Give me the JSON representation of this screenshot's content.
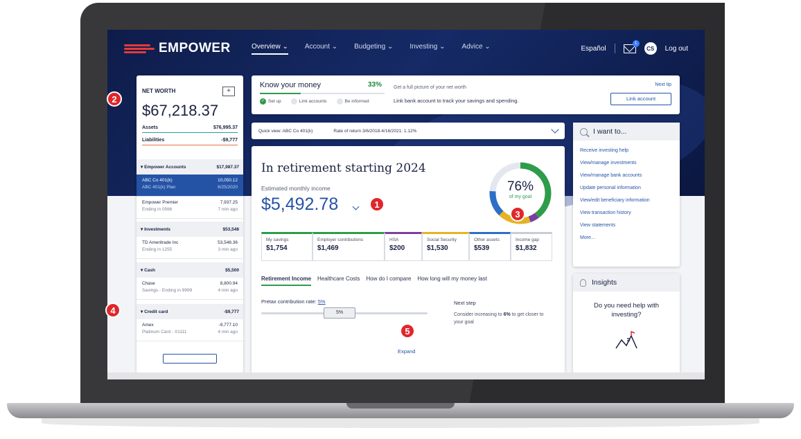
{
  "header": {
    "brand": "EMPOWER",
    "nav": [
      {
        "label": "Overview ⌄"
      },
      {
        "label": "Account ⌄"
      },
      {
        "label": "Budgeting ⌄"
      },
      {
        "label": "Investing ⌄"
      },
      {
        "label": "Advice ⌄"
      }
    ],
    "language": "Español",
    "mail_badge": "1",
    "avatar_initials": "CS",
    "logout": "Log out"
  },
  "net_worth": {
    "title": "NET WORTH",
    "add_label": "+",
    "value": "$67,218.37",
    "assets_label": "Assets",
    "assets_value": "$76,995.37",
    "liabilities_label": "Liabilities",
    "liabilities_value": "-$9,777",
    "sections": [
      {
        "label": "▾ Empower Accounts",
        "value": "$17,987.37"
      },
      {
        "label": "▾ Investments",
        "value": "$53,548"
      },
      {
        "label": "▾ Cash",
        "value": "$5,500"
      },
      {
        "label": "▾ Credit card",
        "value": "-$9,777"
      }
    ],
    "items": [
      {
        "name": "ABC Co 401(k)",
        "value": "10,050.12",
        "sub": "ABC 401(k) Plan",
        "meta": "6/25/2020"
      },
      {
        "name": "Empower Premier",
        "value": "7,937.25",
        "sub": "Ending in 0566",
        "meta": "7 min ago"
      },
      {
        "name": "TD Ameritrade Inc",
        "value": "53,548.36",
        "sub": "Ending in 1255",
        "meta": "3 min ago"
      },
      {
        "name": "Chase",
        "value": "8,800.94",
        "sub": "Savings - Ending in 9999",
        "meta": "4 min ago"
      },
      {
        "name": "Amex",
        "value": "-9,777.10",
        "sub": "Platinum Card - X1111",
        "meta": "4 min ago"
      }
    ]
  },
  "know_money": {
    "title": "Know your money",
    "percent": "33%",
    "progress": 0.33,
    "steps": [
      "Set up",
      "Link accounts",
      "Be informed"
    ],
    "desc1": "Get a full picture of your net worth",
    "desc2": "Link bank account to track your savings and spending.",
    "next_tip": "Next tip",
    "button": "Link account"
  },
  "quick_view": {
    "account": "Quick view: ABC Co 401(k)",
    "rate": "Rate of return 3/6/2018-4/16/2021: 1.12%"
  },
  "retirement": {
    "title": "In retirement starting 2024",
    "subtitle": "Estimated monthly income",
    "value": "$5,492.78",
    "goal_percent": "76%",
    "goal_label": "of my goal",
    "categories": [
      {
        "label": "My savings",
        "value": "$1,754",
        "color": "#2e9c4a"
      },
      {
        "label": "Employer contributions",
        "value": "$1,469",
        "color": "#2e9c4a"
      },
      {
        "label": "HSA",
        "value": "$200",
        "color": "#7b3fa0"
      },
      {
        "label": "Social Security",
        "value": "$1,530",
        "color": "#e6b323"
      },
      {
        "label": "Other assets",
        "value": "$539",
        "color": "#2d6fc7"
      },
      {
        "label": "Income gap",
        "value": "$1,832",
        "color": "#c8ccd6"
      }
    ],
    "tabs": [
      "Retirement Income",
      "Healthcare Costs",
      "How do I compare",
      "How long will my money last"
    ],
    "pretax_label": "Pretax contribution rate:",
    "pretax_value": "5%",
    "slider_value": "5%",
    "next_step_title": "Next step",
    "next_step_text_a": "Consider increasing to ",
    "next_step_bold": "6%",
    "next_step_text_b": " to get closer to your goal",
    "expand": "Expand"
  },
  "i_want_to": {
    "title": "I want to...",
    "links": [
      "Receive investing help",
      "View/manage investments",
      "View/manage bank accounts",
      "Update personal information",
      "View/edit beneficiary information",
      "View transaction history",
      "View statements",
      "More..."
    ]
  },
  "insights": {
    "title": "Insights",
    "question": "Do you need help with investing?"
  },
  "callouts": [
    "1",
    "2",
    "3",
    "4",
    "5"
  ],
  "colors": {
    "brand_navy": "#142a66",
    "accent_blue": "#2453a6",
    "accent_green": "#2e9c4a",
    "callout_red": "#e0262b"
  }
}
